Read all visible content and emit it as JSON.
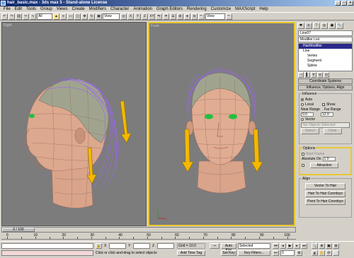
{
  "window": {
    "title": "hair_basic.max - 3ds max 5 - Stand-alone License",
    "minimize": "_",
    "maximize": "□",
    "close": "×"
  },
  "menu": [
    "File",
    "Edit",
    "Tools",
    "Group",
    "Views",
    "Create",
    "Modifiers",
    "Character",
    "Animation",
    "Graph Editors",
    "Rendering",
    "Customize",
    "MAXScript",
    "Help"
  ],
  "toolbar": {
    "filter_value": "All",
    "refcoord_value": "View",
    "named_sel_value": "View"
  },
  "viewports": {
    "left_label": "Right",
    "right_label": "Front"
  },
  "command_panel": {
    "object_name": "Line07",
    "modifier_list": "Modifier List",
    "stack": [
      "HairModifier",
      "Line",
      "Vertex",
      "Segment",
      "Spline"
    ],
    "rollout_coordinate": "Coordinate Systems",
    "rollout_influence": "Influence, Options, Align",
    "influence_group": "Influence",
    "auto_label": "Auto",
    "local_label": "Local",
    "near_range_label": "Near Range",
    "near_range_value": "0.0",
    "show_label": "Show",
    "far_range_label": "Far Range",
    "far_range_value": "12.0",
    "vector_label": "Vector",
    "no_objects_label": "No Objects Selected",
    "select_label": "Select",
    "clear_label": "Clear",
    "options_group": "Options",
    "start_frame_label": "Start Frame",
    "absolute_on_label": "Absolute On",
    "absolute_on_value": "1.0",
    "attraction_label": "Attraction",
    "align_group": "Align",
    "vector_to_hair": "Vector To Hair",
    "hair_to_hair_coords": "Hair To Hair Coordsys",
    "pivot_to_hair_coords": "Pivot To Hair Coordsys"
  },
  "timeline": {
    "slider_label": "0 / 100",
    "ruler_labels": [
      "0",
      "10",
      "20",
      "30",
      "40",
      "50",
      "60",
      "70",
      "80",
      "90",
      "100"
    ]
  },
  "status": {
    "lock_icon": "lock-icon",
    "x_label": "X",
    "y_label": "Y",
    "z_label": "Z",
    "grid_text": "Grid = 10.0",
    "prompt_text": "Click or click-and-drag to select objects",
    "add_time_tag": "Add Time Tag",
    "auto_key": "Auto Key",
    "set_key": "Set Key",
    "key_filters": "Key Filters...",
    "selected_value": "Selected",
    "frame_value": "0"
  },
  "colors": {
    "accent": "#e8c830",
    "viewport_bg": "#7c7c7c",
    "arrow": "#f5b800"
  }
}
